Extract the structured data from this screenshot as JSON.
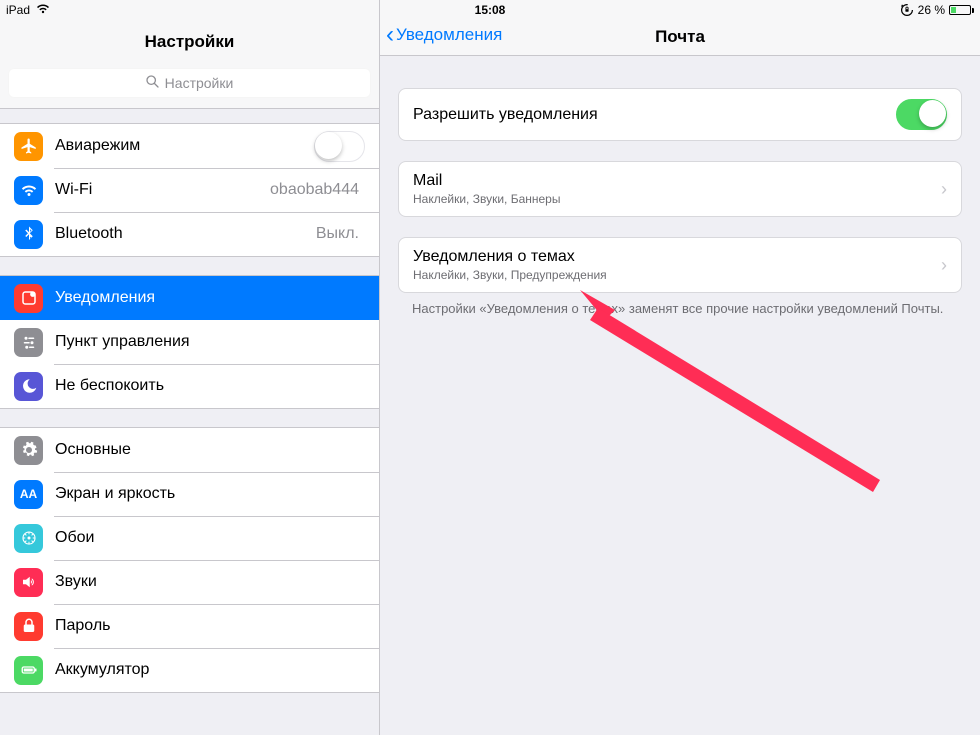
{
  "statusbar": {
    "device": "iPad",
    "time": "15:08",
    "battery_pct": "26 %"
  },
  "sidebar": {
    "title": "Настройки",
    "search_placeholder": "Настройки",
    "group1": {
      "airplane": "Авиарежим",
      "wifi_label": "Wi-Fi",
      "wifi_value": "obaobab444",
      "bt_label": "Bluetooth",
      "bt_value": "Выкл."
    },
    "group2": {
      "notifications": "Уведомления",
      "control_center": "Пункт управления",
      "dnd": "Не беспокоить"
    },
    "group3": {
      "general": "Основные",
      "display": "Экран и яркость",
      "wallpaper": "Обои",
      "sounds": "Звуки",
      "passcode": "Пароль",
      "battery": "Аккумулятор"
    }
  },
  "detail": {
    "back_label": "Уведомления",
    "title": "Почта",
    "allow_label": "Разрешить уведомления",
    "mail": {
      "title": "Mail",
      "sub": "Наклейки, Звуки, Баннеры"
    },
    "threads": {
      "title": "Уведомления о темах",
      "sub": "Наклейки, Звуки, Предупреждения"
    },
    "footer": "Настройки «Уведомления о темах» заменят все прочие настройки уведомлений Почты."
  }
}
